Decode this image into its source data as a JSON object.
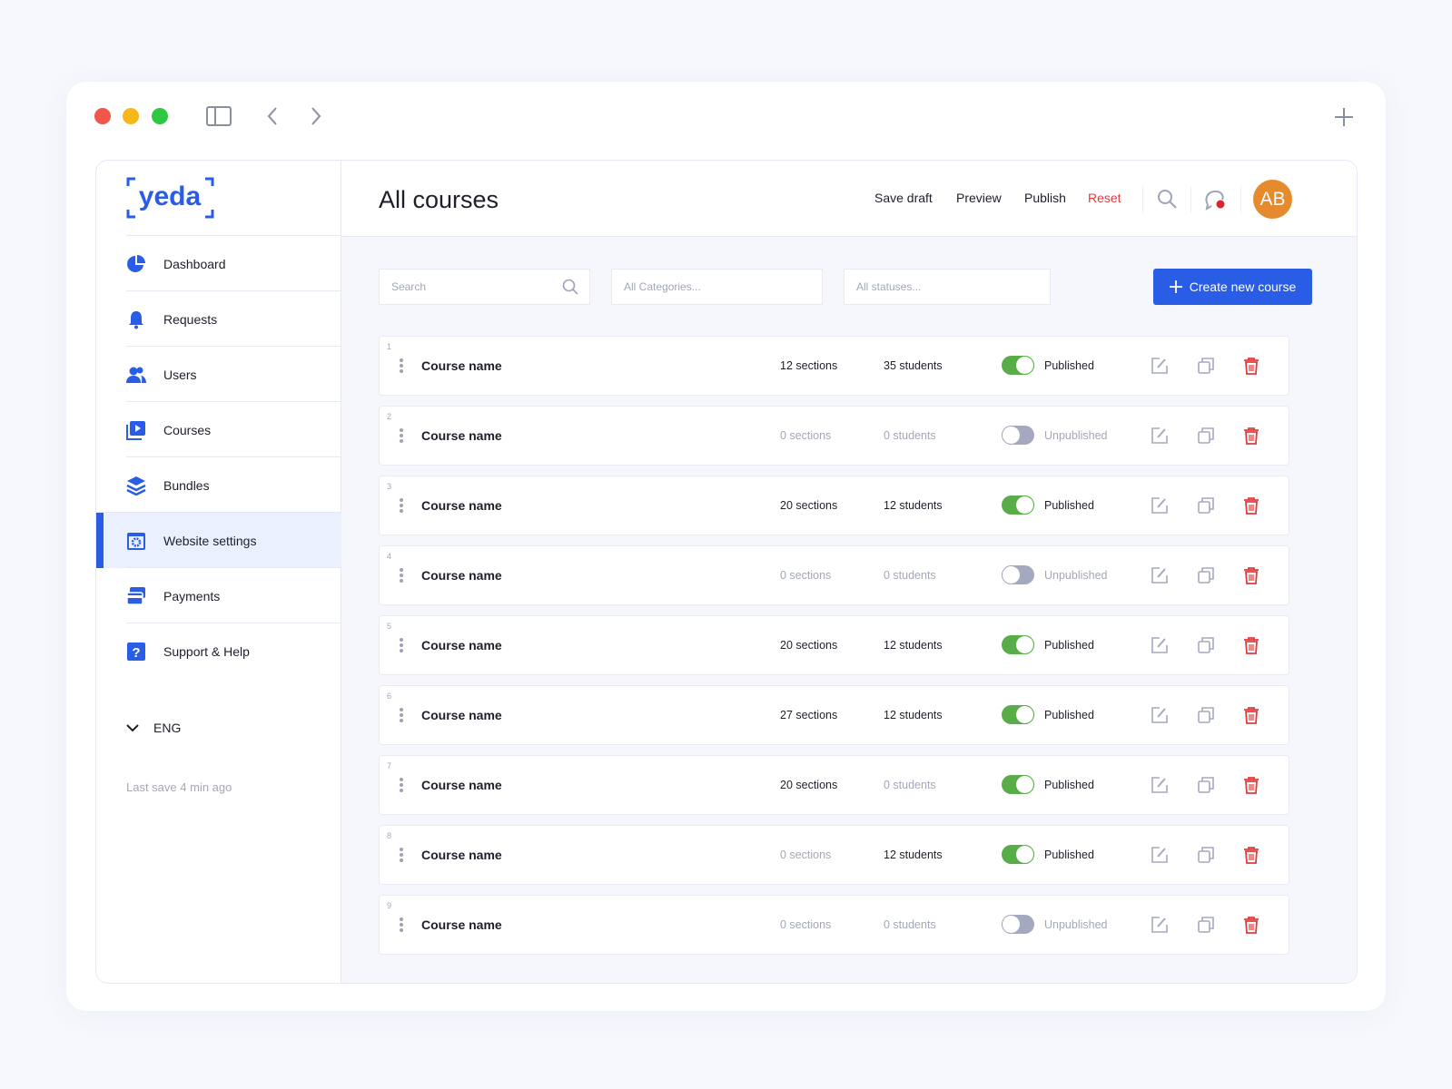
{
  "window": {
    "controls": [
      "close",
      "minimize",
      "maximize"
    ]
  },
  "sidebar": {
    "logo": "yeda",
    "items": [
      {
        "label": "Dashboard",
        "icon": "pie-chart-icon"
      },
      {
        "label": "Requests",
        "icon": "bell-icon"
      },
      {
        "label": "Users",
        "icon": "users-icon"
      },
      {
        "label": "Courses",
        "icon": "play-icon"
      },
      {
        "label": "Bundles",
        "icon": "layers-icon"
      },
      {
        "label": "Website settings",
        "icon": "settings-icon",
        "active": true
      },
      {
        "label": "Payments",
        "icon": "credit-card-icon"
      },
      {
        "label": "Support & Help",
        "icon": "help-icon"
      }
    ],
    "language": "ENG",
    "last_save": "Last save 4 min ago"
  },
  "header": {
    "title": "All courses",
    "save_draft": "Save draft",
    "preview": "Preview",
    "publish": "Publish",
    "reset": "Reset",
    "avatar": "AB"
  },
  "filters": {
    "search_placeholder": "Search",
    "categories_placeholder": "All Categories...",
    "statuses_placeholder": "All statuses...",
    "create_label": "Create new course"
  },
  "colors": {
    "accent": "#2a5de6",
    "published": "#58ad48",
    "reset": "#e03c3c",
    "avatar": "#e68a2e"
  },
  "courses": [
    {
      "num": "1",
      "name": "Course name",
      "sections": "12 sections",
      "students": "35 students",
      "published": true,
      "status": "Published"
    },
    {
      "num": "2",
      "name": "Course name",
      "sections": "0 sections",
      "students": "0 students",
      "published": false,
      "status": "Unpublished"
    },
    {
      "num": "3",
      "name": "Course name",
      "sections": "20 sections",
      "students": "12 students",
      "published": true,
      "status": "Published"
    },
    {
      "num": "4",
      "name": "Course name",
      "sections": "0 sections",
      "students": "0 students",
      "published": false,
      "status": "Unpublished"
    },
    {
      "num": "5",
      "name": "Course name",
      "sections": "20 sections",
      "students": "12 students",
      "published": true,
      "status": "Published"
    },
    {
      "num": "6",
      "name": "Course name",
      "sections": "27 sections",
      "students": "12 students",
      "published": true,
      "status": "Published"
    },
    {
      "num": "7",
      "name": "Course name",
      "sections": "20 sections",
      "students": "0 students",
      "published": true,
      "status": "Published"
    },
    {
      "num": "8",
      "name": "Course name",
      "sections": "0 sections",
      "students": "12 students",
      "published": true,
      "status": "Published"
    },
    {
      "num": "9",
      "name": "Course name",
      "sections": "0 sections",
      "students": "0 students",
      "published": false,
      "status": "Unpublished"
    }
  ]
}
